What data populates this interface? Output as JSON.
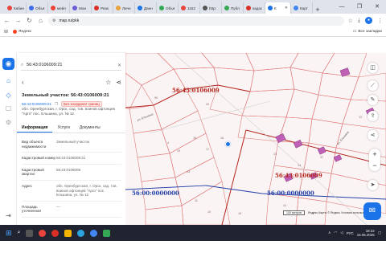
{
  "browser": {
    "tabs": [
      {
        "label": "Кабин",
        "color": "#e8453c"
      },
      {
        "label": "Объя",
        "color": "#3c6ee8"
      },
      {
        "label": "мейл",
        "color": "#ea4335"
      },
      {
        "label": "Мои",
        "color": "#6b5cd6"
      },
      {
        "label": "Реак",
        "color": "#d93025"
      },
      {
        "label": "Личн",
        "color": "#e8a33c"
      },
      {
        "label": "Данн",
        "color": "#1a73e8"
      },
      {
        "label": "Объя",
        "color": "#34a853"
      },
      {
        "label": "1152",
        "color": "#e8453c"
      },
      {
        "label": "http:",
        "color": "#555555"
      },
      {
        "label": "Публ",
        "color": "#34a853"
      },
      {
        "label": "кадас",
        "color": "#d93025"
      },
      {
        "label": "К",
        "color": "#1a73e8",
        "active": true
      },
      {
        "label": "Карт",
        "color": "#4285f4"
      }
    ],
    "new_tab": "+",
    "window_controls": [
      "—",
      "❐",
      "✕"
    ],
    "url": "map.ru/pkk",
    "bookmarks": [
      {
        "label": "Яндекс",
        "color": "#fc3f1d"
      }
    ],
    "all_bookmarks": "Все закладки"
  },
  "panel": {
    "search_value": "56:43:0106009:21",
    "title": "Земельный участок: 56:43:0106009:21",
    "cadastral_link": "56:43:0106009:21",
    "badge": "Без координат границ",
    "address_short": "обл. Оренбургская, г. Орск, сад. тов. воинов офтонцев \"Арго\" пос. Ельшина, ул. № 12",
    "tabs": [
      "Информация",
      "Услуги",
      "Документы"
    ],
    "rows": [
      {
        "key": "Вид объекта недвижимости",
        "value": "Земельный участок"
      },
      {
        "key": "Кадастровый номер",
        "value": "56:43:0106009:21"
      },
      {
        "key": "Кадастровый квартал",
        "value": "56:43:0106009"
      },
      {
        "key": "Адрес",
        "value": "обл. Оренбургская, г. Орск, сад. тов. воинов офтонцев \"Арго\" пос. Ельшина, ул. № 12"
      },
      {
        "key": "Площадь уточненная",
        "value": "—"
      }
    ]
  },
  "map": {
    "labels": [
      {
        "text": "56:43:0106009",
        "kind": "red"
      },
      {
        "text": "56:43:0106009",
        "kind": "red"
      },
      {
        "text": "56:00:0000000",
        "kind": "blue"
      },
      {
        "text": "56:00:0000000",
        "kind": "blue"
      }
    ],
    "street_labels": [
      "ул. Ельшина",
      "ул. Ельшина"
    ],
    "parcel_numbers": [
      "90",
      "16",
      "19",
      "4",
      "17",
      "16",
      "20",
      "13",
      "11",
      "10",
      "15",
      "14",
      "37",
      "12",
      "41",
      "5",
      "9",
      "19"
    ],
    "attribution": "Яндекс Карты © Яндекс Условия использования",
    "scale": "100 метров"
  },
  "taskbar": {
    "time": "18:22",
    "date": "15.05.2025",
    "lang": "РУС"
  },
  "colors": {
    "accent": "#1a73e8",
    "parcel_red": "#b3261e",
    "quarter_blue": "#1f3fa8",
    "building": "#c05fb6"
  }
}
